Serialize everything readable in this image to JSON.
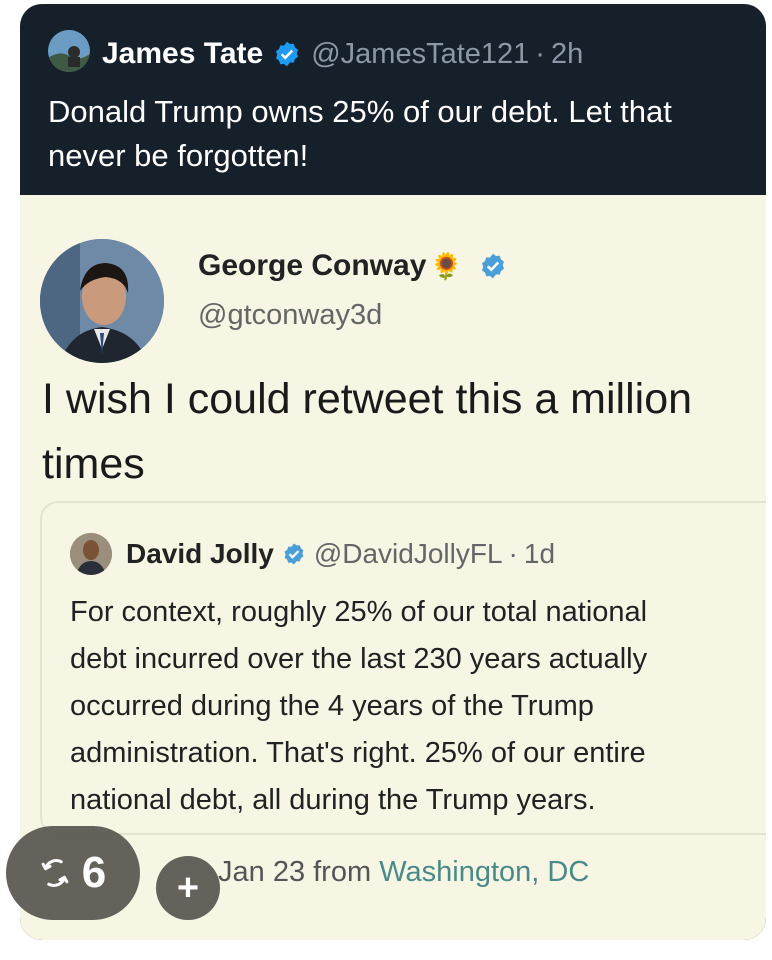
{
  "post": {
    "author_name": "James Tate",
    "handle": "@JamesTate121",
    "separator": "·",
    "time": "2h",
    "text": "Donald Trump owns 25% of our debt. Let that never be forgotten!"
  },
  "embedded": {
    "author_name": "George Conway",
    "author_emoji": "🌻",
    "handle": "@gtconway3d",
    "text": "I wish I could retweet this a million times",
    "meta_prefix": "Jan 23 from",
    "meta_location": "Washington, DC",
    "quote": {
      "author_name": "David Jolly",
      "handle": "@DavidJollyFL",
      "separator": "·",
      "time": "1d",
      "lines": [
        "For context, roughly 25% of our total national",
        "debt incurred over the last 230 years actually",
        "occurred during the 4 years of the Trump",
        "administration. That's right. 25% of our entire",
        "national debt, all during the Trump years."
      ]
    }
  },
  "overlay": {
    "retweet_count": "6",
    "retweet_icon": "retweet-icon",
    "add_label": "+"
  },
  "colors": {
    "card_bg": "#15202b",
    "image_bg": "#f7f5e4",
    "verified_blue": "#1d9bf0",
    "link": "#4b8a8a"
  }
}
